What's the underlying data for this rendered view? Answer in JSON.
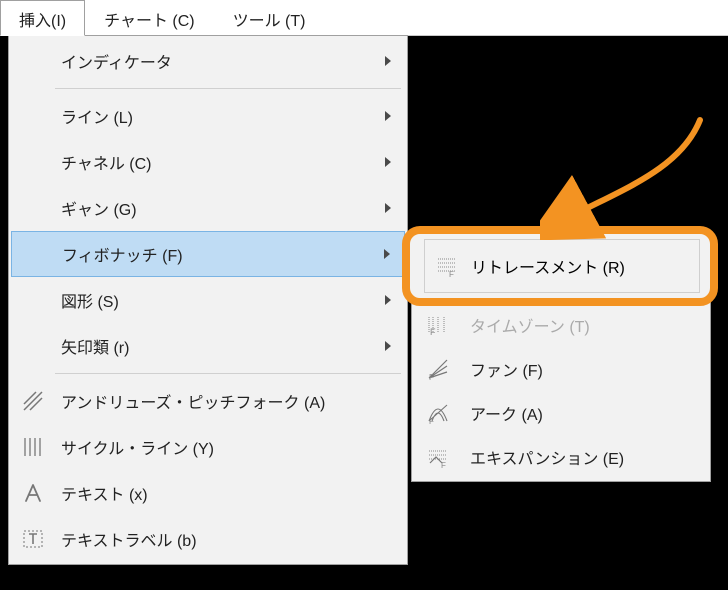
{
  "menubar": {
    "insert": "挿入(I)",
    "chart": "チャート (C)",
    "tools": "ツール (T)"
  },
  "menu": {
    "indicators": "インディケータ",
    "line": "ライン (L)",
    "channel": "チャネル (C)",
    "gann": "ギャン (G)",
    "fibonacci": "フィボナッチ (F)",
    "shapes": "図形 (S)",
    "arrows": "矢印類 (r)",
    "pitchfork": "アンドリューズ・ピッチフォーク (A)",
    "cyclelines": "サイクル・ライン (Y)",
    "text": "テキスト (x)",
    "textlabel": "テキストラベル (b)"
  },
  "fibo_submenu": {
    "retracement": "リトレースメント (R)",
    "timezones": "タイムゾーン (T)",
    "fan": "ファン (F)",
    "arc": "アーク (A)",
    "expansion": "エキスパンション (E)"
  }
}
